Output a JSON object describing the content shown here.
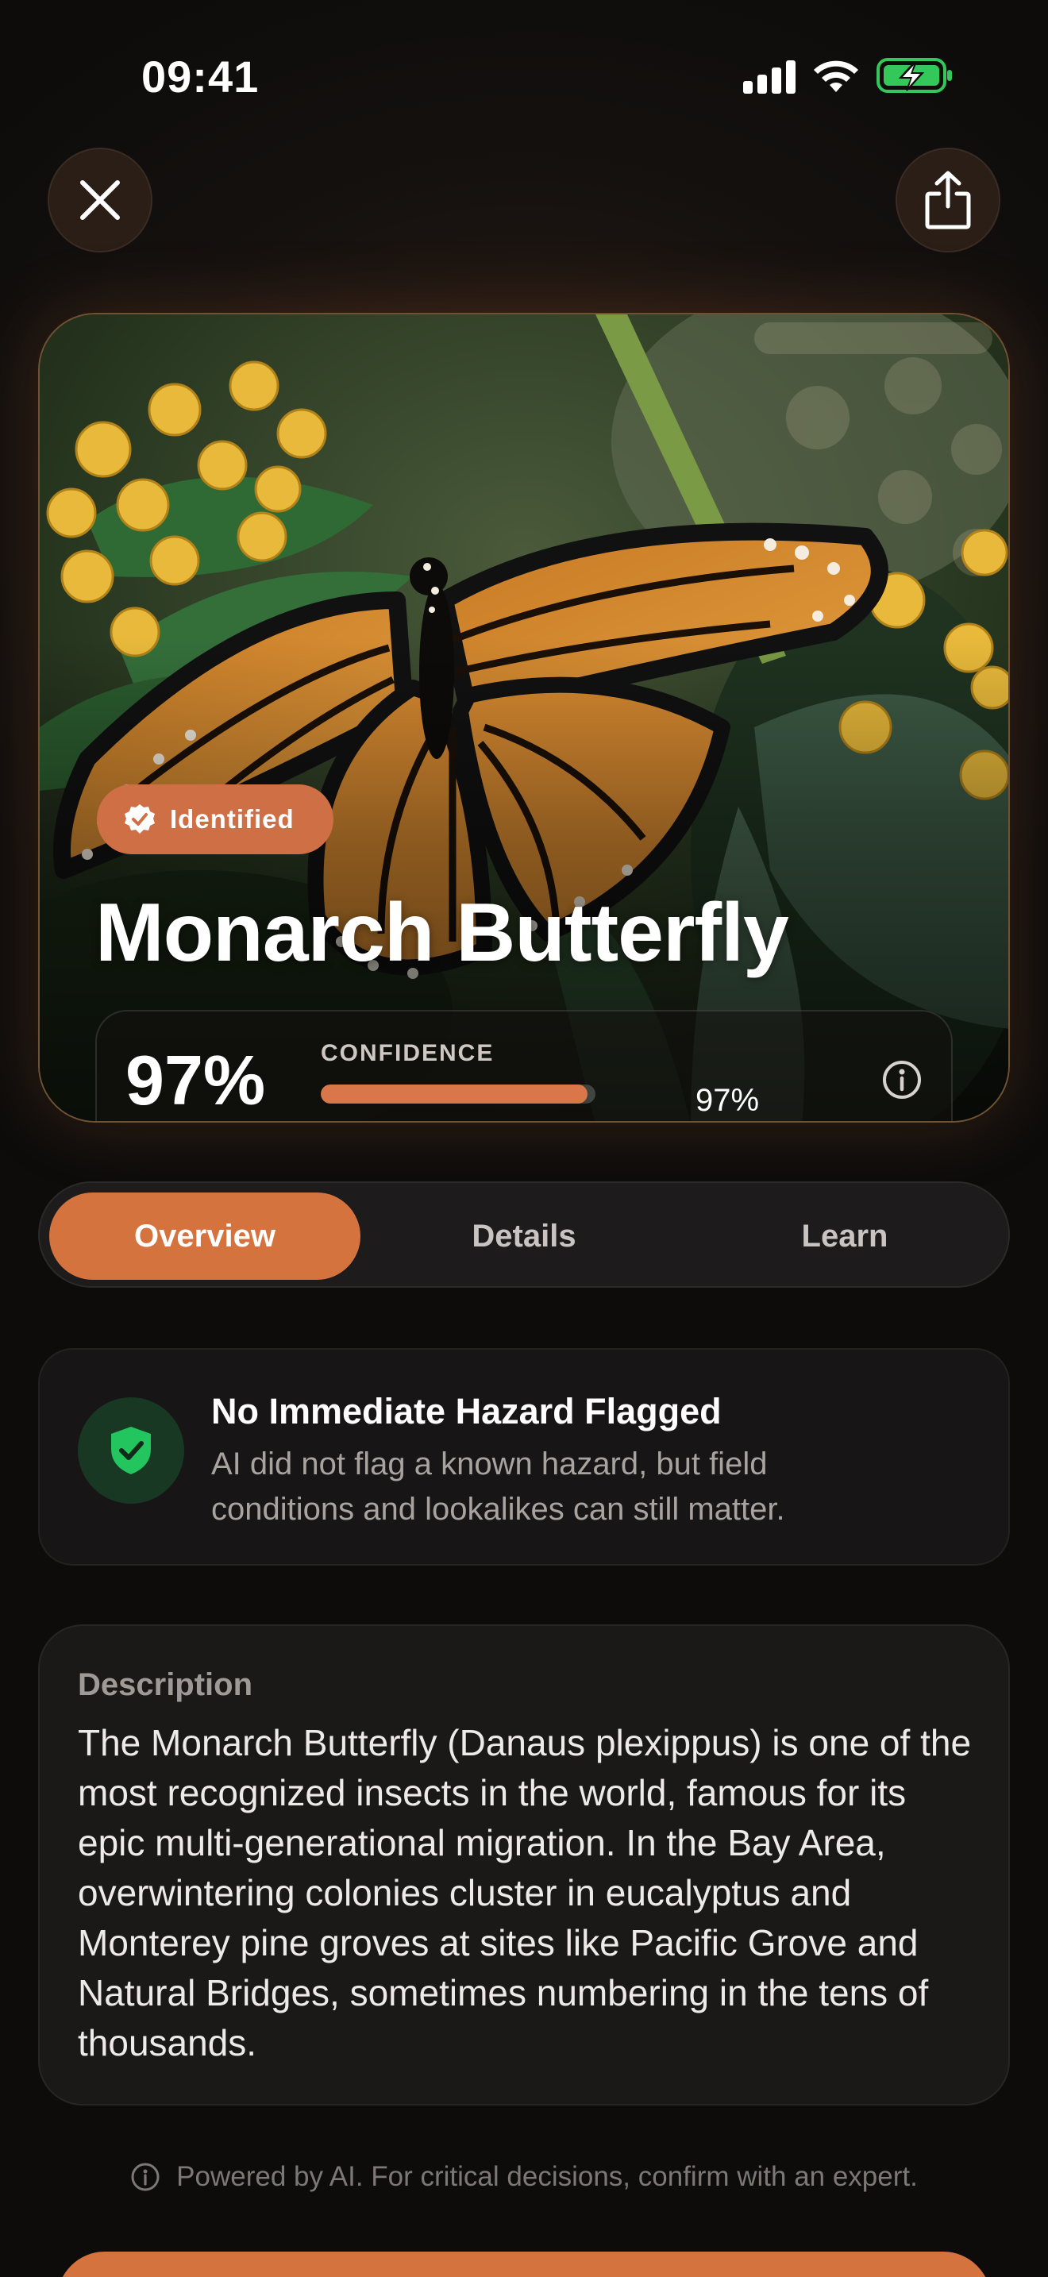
{
  "status_bar": {
    "time": "09:41"
  },
  "header": {
    "close_icon": "close-icon",
    "share_icon": "share-icon"
  },
  "hero": {
    "badge_label": "Identified",
    "title": "Monarch Butterfly",
    "confidence": {
      "percent_text": "97%",
      "label": "CONFIDENCE",
      "value_text": "97%",
      "fill_fraction": 0.97
    }
  },
  "tabs": [
    {
      "label": "Overview",
      "active": true
    },
    {
      "label": "Details",
      "active": false
    },
    {
      "label": "Learn",
      "active": false
    }
  ],
  "hazard": {
    "title": "No Immediate Hazard Flagged",
    "description": "AI did not flag a known hazard, but field conditions and lookalikes can still matter."
  },
  "description": {
    "label": "Description",
    "text": "The Monarch Butterfly (Danaus plexippus) is one of the most recognized insects in the world, famous for its epic multi-generational migration. In the Bay Area, overwintering colonies cluster in eucalyptus and Monterey pine groves at sites like Pacific Grove and Natural Bridges, sometimes numbering in the tens of thousands."
  },
  "footer": {
    "note": "Powered by AI. For critical decisions, confirm with an expert."
  },
  "colors": {
    "accent": "#d5733f",
    "badge": "#cf6f45",
    "safe_green": "#22c55e",
    "battery_green": "#34c759"
  }
}
